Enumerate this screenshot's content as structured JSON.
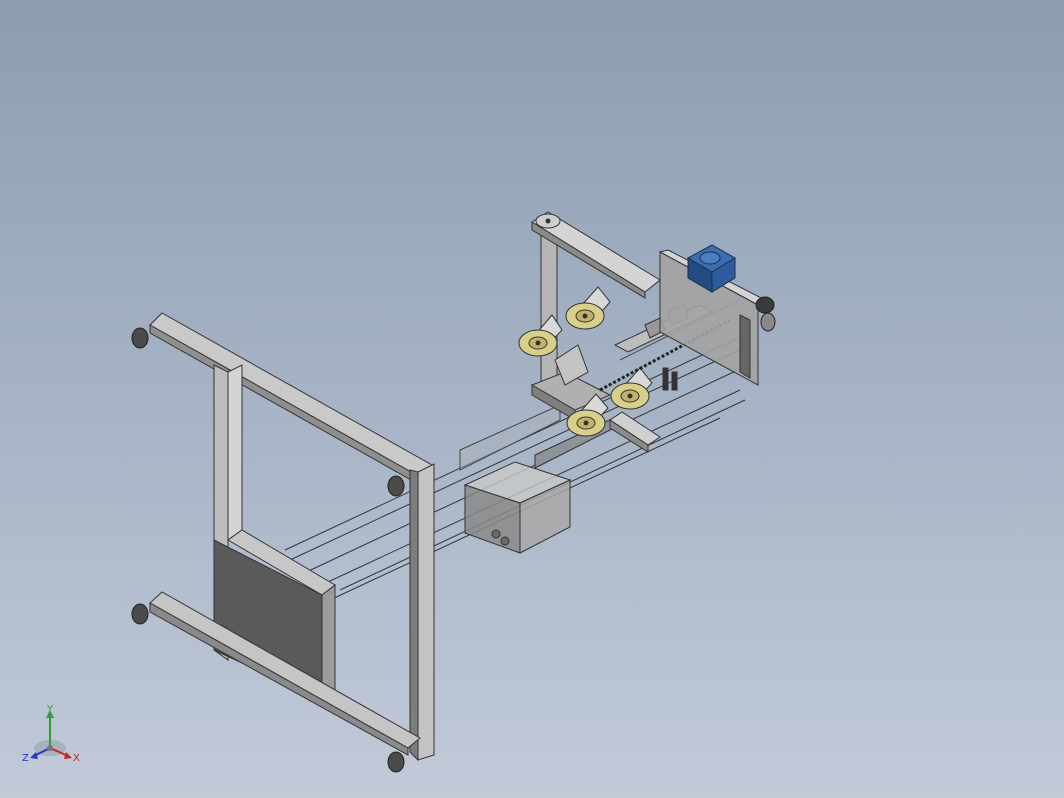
{
  "viewport": {
    "background_top": "#8d9db0",
    "background_bottom": "#c2cad8",
    "model": "conveyor-frame-assembly-isometric"
  },
  "triad": {
    "x_label": "X",
    "y_label": "Y",
    "z_label": "Z",
    "x_color": "#c0262b",
    "y_color": "#2ea12e",
    "z_color": "#2436c8"
  },
  "colors": {
    "frame": "#b9b9b9",
    "frame_dark": "#555555",
    "motor": "#2a5c9a",
    "pulley": "#d8cf8a",
    "plate": "#9a9a9a"
  }
}
